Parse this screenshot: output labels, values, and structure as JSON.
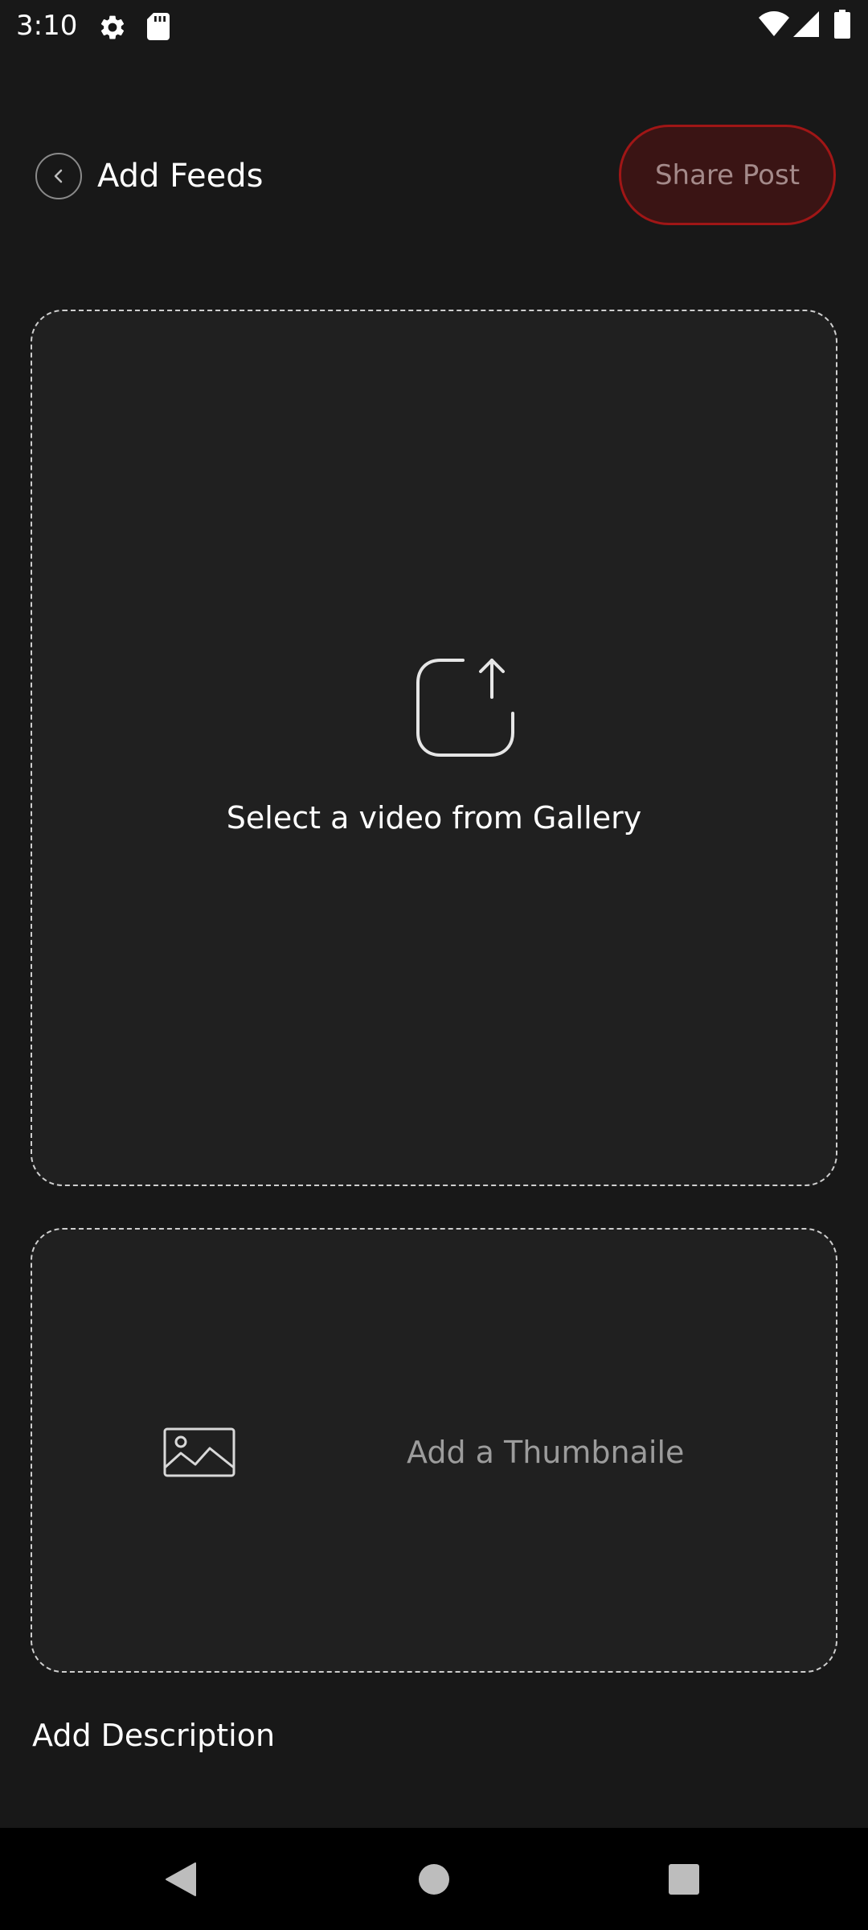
{
  "status_bar": {
    "time": "3:10",
    "icons": [
      "gear-icon",
      "sd-card-icon",
      "wifi-icon",
      "cell-signal-icon",
      "battery-icon"
    ]
  },
  "header": {
    "title": "Add Feeds",
    "back_icon": "chevron-left-icon",
    "share_label": "Share Post"
  },
  "video_picker": {
    "icon": "upload-icon",
    "label": "Select a video from Gallery"
  },
  "thumbnail_picker": {
    "icon": "image-icon",
    "label": "Add a Thumbnaile"
  },
  "description": {
    "label": "Add Description"
  },
  "nav_bar": {
    "buttons": [
      "back-triangle-icon",
      "home-circle-icon",
      "recents-square-icon"
    ]
  },
  "colors": {
    "background": "#181818",
    "card": "#202020",
    "accent": "#a01616",
    "accent_fill": "#3a1414"
  }
}
